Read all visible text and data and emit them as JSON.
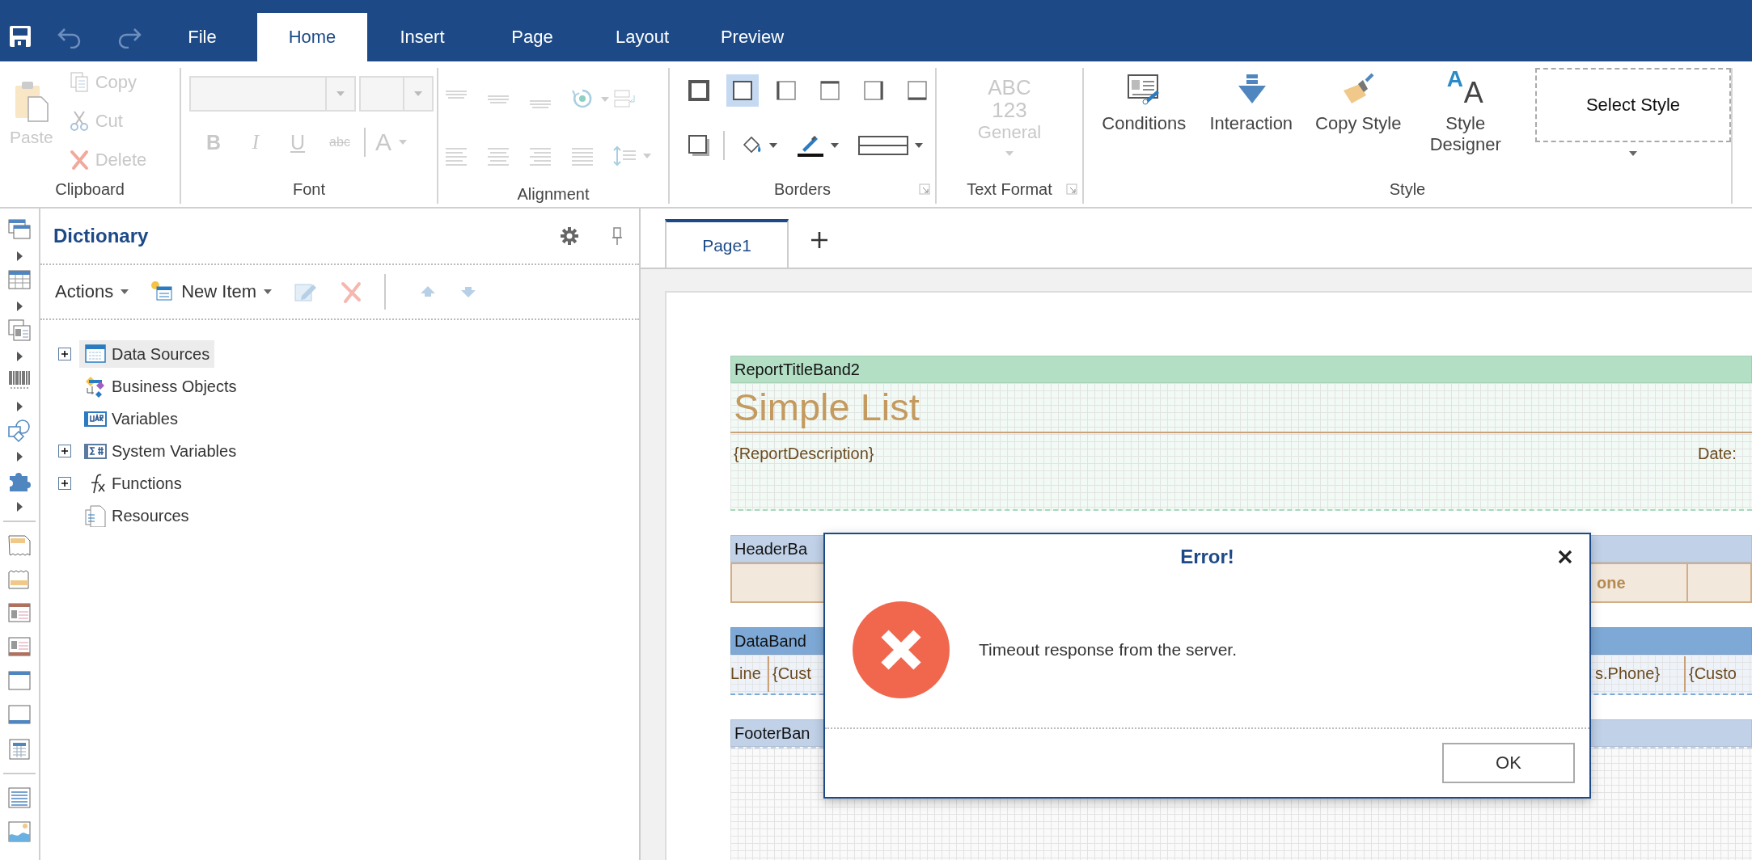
{
  "toolbar": {
    "tabs": [
      {
        "label": "File",
        "selected": false
      },
      {
        "label": "Home",
        "selected": true
      },
      {
        "label": "Insert",
        "selected": false
      },
      {
        "label": "Page",
        "selected": false
      },
      {
        "label": "Layout",
        "selected": false
      },
      {
        "label": "Preview",
        "selected": false
      }
    ]
  },
  "ribbon": {
    "clipboard": {
      "label": "Clipboard",
      "paste": {
        "label": "Paste",
        "disabled": true
      },
      "items": [
        {
          "kind": "copy",
          "label": "Copy",
          "disabled": true
        },
        {
          "kind": "cut",
          "label": "Cut",
          "disabled": true
        },
        {
          "kind": "delete",
          "label": "Delete",
          "disabled": true
        }
      ]
    },
    "font": {
      "label": "Font",
      "disabled": true,
      "styles": [
        {
          "kind": "bold",
          "label": "B"
        },
        {
          "kind": "italic",
          "label": "I"
        },
        {
          "kind": "underline",
          "label": "U"
        },
        {
          "kind": "strike",
          "label": "abc"
        },
        {
          "kind": "color",
          "label": "A"
        }
      ]
    },
    "alignment": {
      "label": "Alignment",
      "disabled": true
    },
    "borders": {
      "label": "Borders",
      "buttons": [
        {
          "kind": "outer",
          "selected": false
        },
        {
          "kind": "all",
          "selected": true
        },
        {
          "kind": "left",
          "selected": false
        },
        {
          "kind": "top",
          "selected": false
        },
        {
          "kind": "right",
          "selected": false
        },
        {
          "kind": "bottom",
          "selected": false
        }
      ]
    },
    "text_format": {
      "label": "Text Format",
      "disabled": true,
      "preview": [
        "ABC",
        "123"
      ],
      "value": "General"
    },
    "style": {
      "label": "Style",
      "buttons": [
        {
          "kind": "conditions",
          "label": "Conditions"
        },
        {
          "kind": "interaction",
          "label": "Interaction"
        },
        {
          "kind": "copy-style",
          "label": "Copy Style"
        },
        {
          "kind": "style-designer",
          "label": "Style Designer",
          "glyphs": [
            "A",
            "A"
          ]
        }
      ],
      "select_style": "Select Style"
    }
  },
  "dictionary": {
    "title": "Dictionary",
    "menus": [
      {
        "label": "Actions"
      },
      {
        "label": "New Item"
      }
    ],
    "tree": [
      {
        "kind": "data-sources",
        "label": "Data Sources",
        "expandable": true,
        "selected": true
      },
      {
        "kind": "business-objects",
        "label": "Business Objects",
        "expandable": false,
        "selected": false
      },
      {
        "kind": "variables",
        "label": "Variables",
        "expandable": false,
        "selected": false
      },
      {
        "kind": "system-variables",
        "label": "System Variables",
        "expandable": true,
        "selected": false
      },
      {
        "kind": "functions",
        "label": "Functions",
        "expandable": true,
        "selected": false
      },
      {
        "kind": "resources",
        "label": "Resources",
        "expandable": false,
        "selected": false
      }
    ]
  },
  "pages": [
    {
      "label": "Page1",
      "selected": true
    }
  ],
  "report": {
    "bands": [
      {
        "kind": "title",
        "label": "ReportTitleBand2",
        "texts": [
          "Simple List",
          "{ReportDescription}",
          "Date:"
        ]
      },
      {
        "kind": "header",
        "label": "HeaderBa",
        "texts": [
          "one"
        ]
      },
      {
        "kind": "data",
        "label": "DataBand",
        "texts": [
          "Line",
          "{Cust",
          "s.Phone}",
          "{Custo"
        ]
      },
      {
        "kind": "footer",
        "label": "FooterBan"
      }
    ]
  },
  "dialog": {
    "title": "Error!",
    "message": "Timeout response from the server.",
    "button": "OK"
  }
}
